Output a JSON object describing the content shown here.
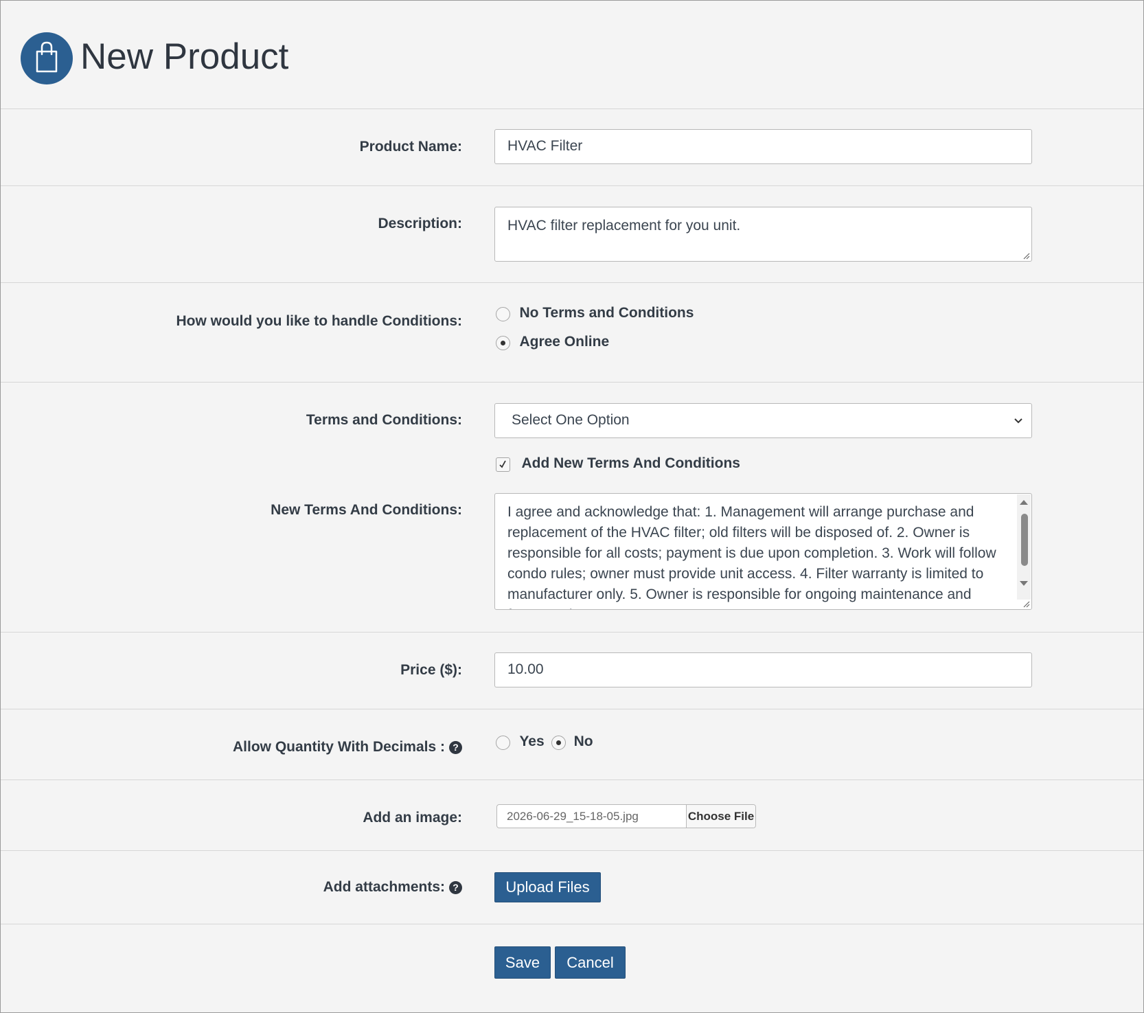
{
  "header": {
    "title": "New Product",
    "icon": "shopping-bag-icon",
    "icon_color": "#2b5f91"
  },
  "form": {
    "product_name": {
      "label": "Product Name:",
      "value": "HVAC Filter"
    },
    "description": {
      "label": "Description:",
      "value": "HVAC filter replacement for you unit."
    },
    "conditions_handling": {
      "label": "How would you like to handle Conditions:",
      "options": [
        "No Terms and Conditions",
        "Agree Online"
      ],
      "selected": "Agree Online"
    },
    "terms": {
      "label": "Terms and Conditions:",
      "selected": "Select One Option",
      "add_new_label": "Add New Terms And Conditions",
      "add_new_checked": true
    },
    "new_terms": {
      "label": "New Terms And Conditions:",
      "value": "I agree and acknowledge that: 1. Management will arrange purchase and replacement of the HVAC filter; old filters will be disposed of. 2. Owner is responsible for all costs; payment is due upon completion. 3. Work will follow condo rules; owner must provide unit access. 4. Filter warranty is limited to manufacturer only. 5. Owner is responsible for ongoing maintenance and future replacements."
    },
    "price": {
      "label": "Price ($):",
      "value": "10.00"
    },
    "decimals": {
      "label": "Allow Quantity With Decimals :",
      "yes_label": "Yes",
      "no_label": "No",
      "selected": "No",
      "help_icon": "question-circle-icon"
    },
    "image": {
      "label": "Add an image:",
      "file_name": "2026-06-29_15-18-05.jpg",
      "choose_label": "Choose File"
    },
    "attachments": {
      "label": "Add attachments:",
      "upload_label": "Upload Files",
      "help_icon": "question-circle-icon"
    }
  },
  "actions": {
    "save_label": "Save",
    "cancel_label": "Cancel"
  },
  "colors": {
    "primary": "#2b5f91",
    "background": "#f4f4f4"
  }
}
